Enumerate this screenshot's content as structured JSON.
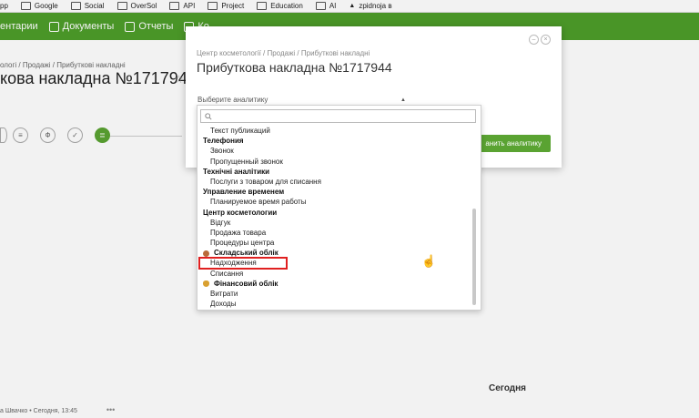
{
  "bookmarks": [
    {
      "label": "pp"
    },
    {
      "label": "Google"
    },
    {
      "label": "Social"
    },
    {
      "label": "OverSol"
    },
    {
      "label": "API"
    },
    {
      "label": "Project"
    },
    {
      "label": "Education"
    },
    {
      "label": "AI"
    },
    {
      "label": "zpidnoja в"
    }
  ],
  "topnav": {
    "items": [
      {
        "label": "ентарии"
      },
      {
        "label": "Документы"
      },
      {
        "label": "Отчеты"
      },
      {
        "label": "Ко"
      }
    ],
    "color": "#4d9e2a"
  },
  "page": {
    "breadcrumb": "ологі / Продажі / Прибуткові накладні",
    "title": "кова накладна №1717944",
    "star": "☆",
    "toolbar_icons": [
      "≡",
      "Ф",
      "✓",
      "≣"
    ],
    "today": "Сегодня",
    "footer_author": "а Швачко • Сегодня, 13:45",
    "footer_more": "•••"
  },
  "modal": {
    "breadcrumb": "Центр косметології / Продажі / Прибуткові накладні",
    "title": "Прибуткова накладна №1717944",
    "select_placeholder": "Выберите аналитику",
    "save_button": "анить аналитику",
    "accent": "#5aa332"
  },
  "dropdown": {
    "search_placeholder": "",
    "items": [
      {
        "label": "Текст публикаций",
        "kind": "opt"
      },
      {
        "label": "Телефония",
        "kind": "group"
      },
      {
        "label": "Звонок",
        "kind": "opt"
      },
      {
        "label": "Пропущенный звонок",
        "kind": "opt"
      },
      {
        "label": "Технічні аналітики",
        "kind": "group"
      },
      {
        "label": "Послуги з товаром для списання",
        "kind": "opt"
      },
      {
        "label": "Управление временем",
        "kind": "group"
      },
      {
        "label": "Планируемое время работы",
        "kind": "opt"
      },
      {
        "label": "Центр косметологии",
        "kind": "group"
      },
      {
        "label": "Відгук",
        "kind": "opt"
      },
      {
        "label": "Продажа товара",
        "kind": "opt"
      },
      {
        "label": "Процедуры центра",
        "kind": "opt"
      },
      {
        "label": "Складський облік",
        "kind": "group",
        "icon": "box-icon",
        "iconColor": "#b86a3a"
      },
      {
        "label": "Надходження",
        "kind": "opt",
        "highlighted": true
      },
      {
        "label": "Списання",
        "kind": "opt"
      },
      {
        "label": "Фінансовий облік",
        "kind": "group",
        "icon": "money-bag-icon",
        "iconColor": "#d9a030"
      },
      {
        "label": "Витрати",
        "kind": "opt"
      },
      {
        "label": "Доходы",
        "kind": "opt"
      }
    ],
    "highlight_color": "#e02020"
  }
}
